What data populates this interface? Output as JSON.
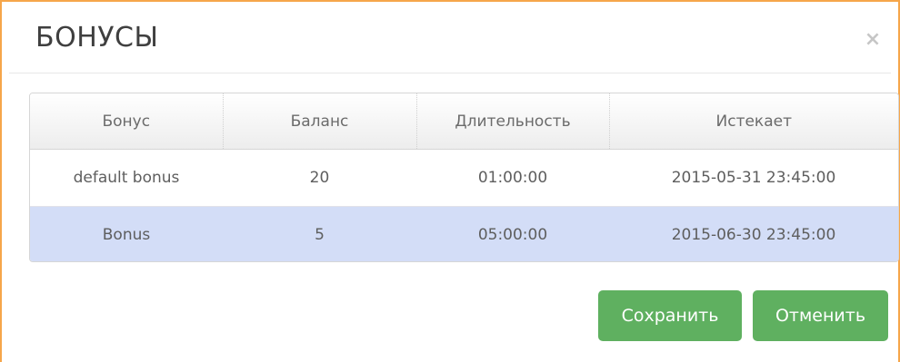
{
  "dialog": {
    "title": "БОНУСЫ",
    "close_symbol": "×"
  },
  "table": {
    "columns": [
      "Бонус",
      "Баланс",
      "Длительность",
      "Истекает"
    ],
    "rows": [
      [
        "default bonus",
        "20",
        "01:00:00",
        "2015-05-31 23:45:00"
      ],
      [
        "Bonus",
        "5",
        "05:00:00",
        "2015-06-30 23:45:00"
      ]
    ],
    "selected_row_index": 1
  },
  "buttons": {
    "save_label": "Сохранить",
    "cancel_label": "Отменить"
  },
  "colors": {
    "accent_border": "#f6a64a",
    "button_green": "#5fb060",
    "selected_row": "#d3ddf7"
  },
  "icons": {
    "close": "close-icon"
  }
}
